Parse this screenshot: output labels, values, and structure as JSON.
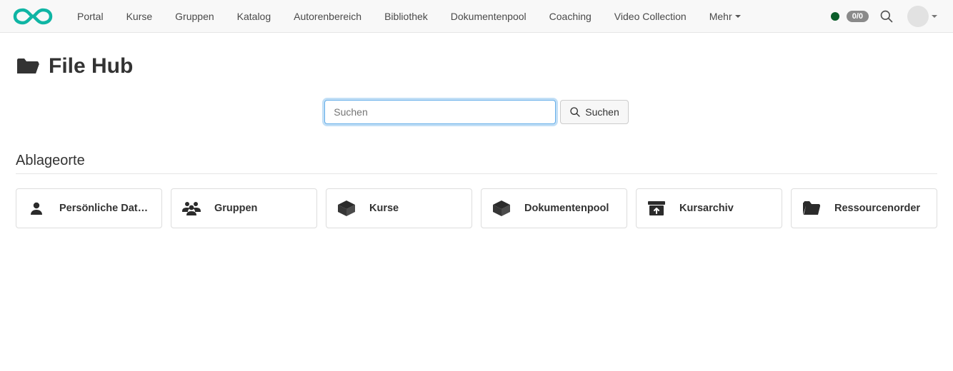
{
  "header": {
    "nav": [
      "Portal",
      "Kurse",
      "Gruppen",
      "Katalog",
      "Autorenbereich",
      "Bibliothek",
      "Dokumentenpool",
      "Coaching",
      "Video Collection"
    ],
    "more_label": "Mehr",
    "badge_text": "0/0",
    "status_color": "#0b5d2a"
  },
  "page": {
    "title": "File Hub"
  },
  "search": {
    "placeholder": "Suchen",
    "button_label": "Suchen"
  },
  "section": {
    "heading": "Ablageorte",
    "cards": [
      {
        "icon": "person",
        "label": "Persönliche Date..."
      },
      {
        "icon": "group",
        "label": "Gruppen"
      },
      {
        "icon": "box",
        "label": "Kurse"
      },
      {
        "icon": "box",
        "label": "Dokumentenpool"
      },
      {
        "icon": "archive",
        "label": "Kursarchiv"
      },
      {
        "icon": "folder",
        "label": "Ressourcenorder"
      }
    ]
  }
}
